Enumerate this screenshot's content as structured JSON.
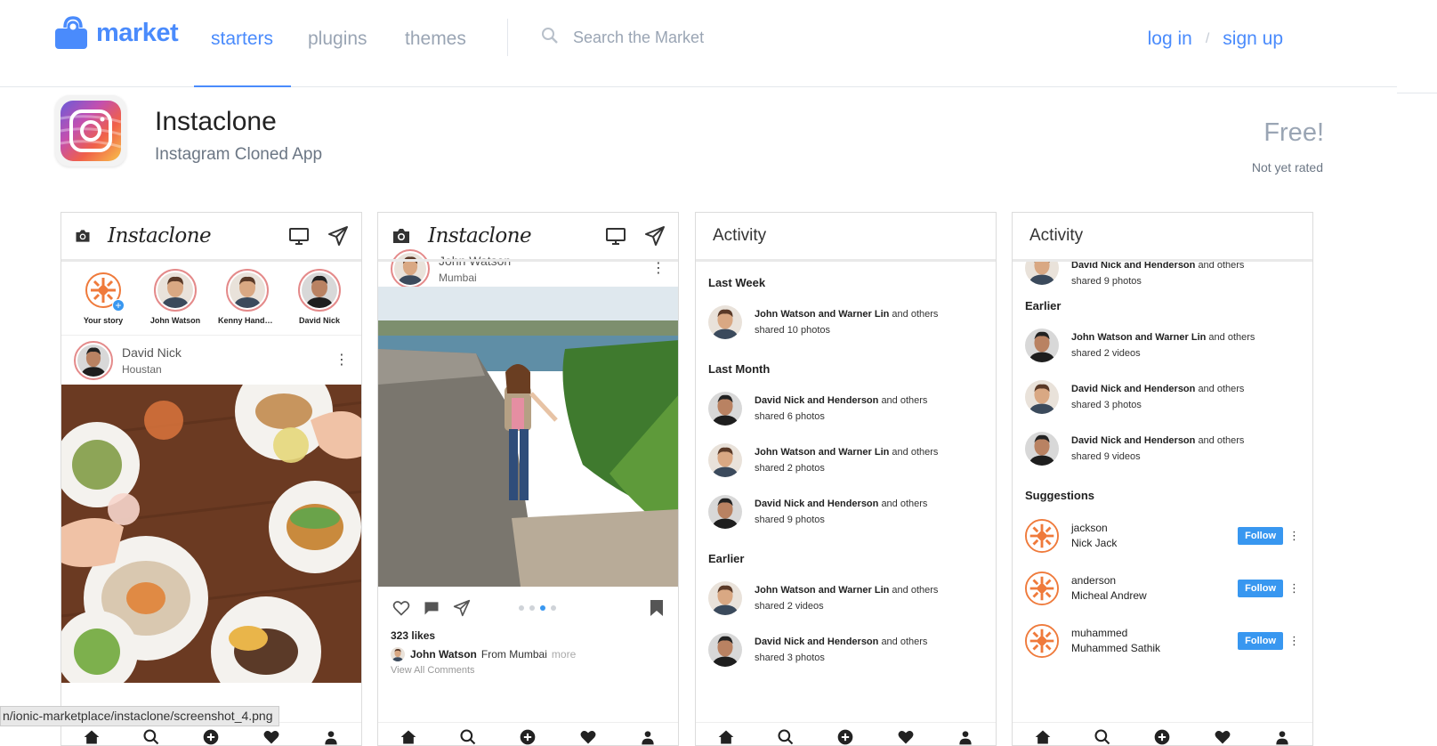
{
  "nav": {
    "logo_text": "market",
    "links": [
      "starters",
      "plugins",
      "themes"
    ],
    "search_placeholder": "Search the Market",
    "login": "log in",
    "separator": "/",
    "signup": "sign up",
    "accent": "#4a8bfc"
  },
  "app": {
    "title": "Instaclone",
    "subtitle": "Instagram Cloned App",
    "price": "Free!",
    "rating": "Not yet rated"
  },
  "shot1": {
    "brand": "Instaclone",
    "stories": [
      "Your story",
      "John Watson",
      "Kenny Hander...",
      "David Nick"
    ],
    "post_name": "David Nick",
    "post_location": "Houstan"
  },
  "shot2": {
    "brand": "Instaclone",
    "post_name": "John Watson",
    "post_location": "Mumbai",
    "likes": "323 likes",
    "caption_user": "John Watson",
    "caption_text": "From Mumbai",
    "caption_more": "more",
    "view_all": "View All Comments"
  },
  "shot3": {
    "title": "Activity",
    "sections": [
      {
        "label": "Last Week",
        "items": [
          {
            "names": "John Watson and Warner Lin",
            "suffix": "and others",
            "detail": "shared 10 photos"
          }
        ]
      },
      {
        "label": "Last Month",
        "items": [
          {
            "names": "David Nick and Henderson",
            "suffix": "and others",
            "detail": "shared 6 photos"
          },
          {
            "names": "John Watson and Warner Lin",
            "suffix": "and others",
            "detail": "shared 2 photos"
          },
          {
            "names": "David Nick and Henderson",
            "suffix": "and others",
            "detail": "shared 9 photos"
          }
        ]
      },
      {
        "label": "Earlier",
        "items": [
          {
            "names": "John Watson and Warner Lin",
            "suffix": "and others",
            "detail": "shared 2 videos"
          },
          {
            "names": "David Nick and Henderson",
            "suffix": "and others",
            "detail": "shared 3 photos"
          }
        ]
      }
    ]
  },
  "shot4": {
    "title": "Activity",
    "top_item": {
      "names": "David Nick and Henderson",
      "suffix": "and others",
      "detail": "shared 9 photos"
    },
    "earlier_label": "Earlier",
    "earlier": [
      {
        "names": "John Watson and Warner Lin",
        "suffix": "and others",
        "detail": "shared 2 videos"
      },
      {
        "names": "David Nick and Henderson",
        "suffix": "and others",
        "detail": "shared 3 photos"
      },
      {
        "names": "David Nick and Henderson",
        "suffix": "and others",
        "detail": "shared 9 videos"
      }
    ],
    "suggestions_label": "Suggestions",
    "suggestions": [
      {
        "user": "jackson",
        "name": "Nick Jack",
        "button": "Follow"
      },
      {
        "user": "anderson",
        "name": "Micheal Andrew",
        "button": "Follow"
      },
      {
        "user": "muhammed",
        "name": "Muhammed Sathik",
        "button": "Follow"
      }
    ]
  },
  "status_url": "n/ionic-marketplace/instaclone/screenshot_4.png"
}
